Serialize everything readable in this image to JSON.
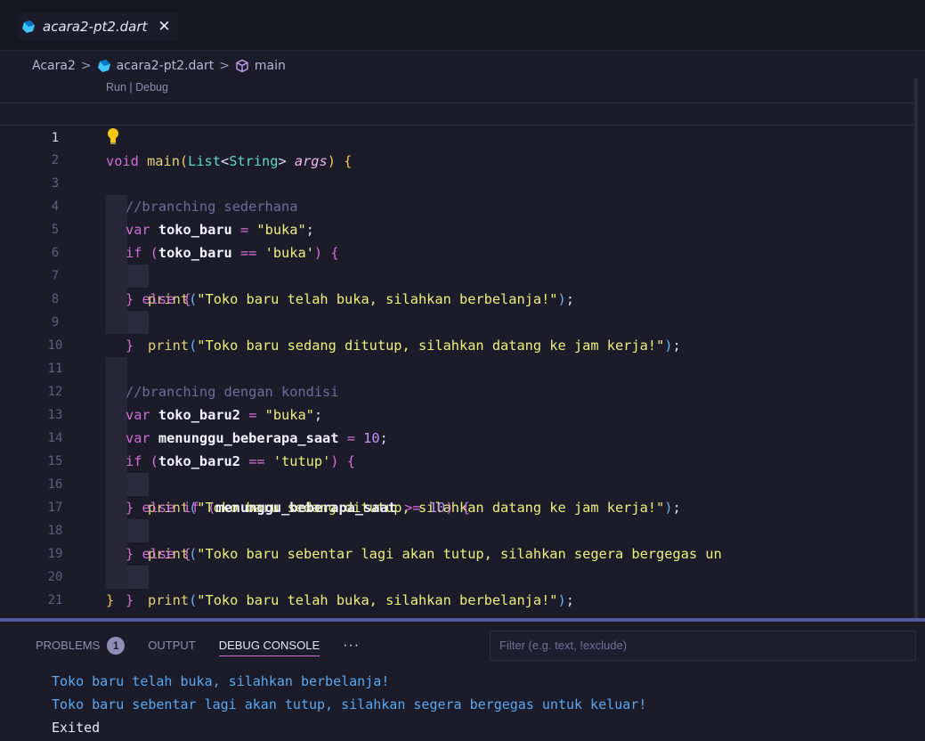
{
  "tab": {
    "title": "acara2-pt2.dart",
    "close_glyph": "✕"
  },
  "breadcrumb": {
    "folder": "Acara2",
    "file": "acara2-pt2.dart",
    "symbol": "main",
    "sep": ">"
  },
  "codelens": "Run | Debug",
  "lines": [
    {
      "n": "1"
    },
    {
      "n": "2"
    },
    {
      "n": "3"
    },
    {
      "n": "4"
    },
    {
      "n": "5"
    },
    {
      "n": "6"
    },
    {
      "n": "7"
    },
    {
      "n": "8"
    },
    {
      "n": "9"
    },
    {
      "n": "10"
    },
    {
      "n": "11"
    },
    {
      "n": "12"
    },
    {
      "n": "13"
    },
    {
      "n": "14"
    },
    {
      "n": "15"
    },
    {
      "n": "16"
    },
    {
      "n": "17"
    },
    {
      "n": "18"
    },
    {
      "n": "19"
    },
    {
      "n": "20"
    },
    {
      "n": "21"
    }
  ],
  "code": {
    "l1": {
      "void": "void",
      "main": "main",
      "list": "List",
      "string": "String",
      "args": "args"
    },
    "l2": {
      "comment": "//branching sederhana"
    },
    "l3": {
      "var": "var",
      "name": "toko_baru",
      "value": "\"buka\""
    },
    "l4": {
      "if": "if",
      "name": "toko_baru",
      "value": "'buka'"
    },
    "l5": {
      "print": "print",
      "value": "\"Toko baru telah buka, silahkan berbelanja!\""
    },
    "l6": {
      "else": "else"
    },
    "l7": {
      "print": "print",
      "value": "\"Toko baru sedang ditutup, silahkan datang ke jam kerja!\""
    },
    "l10": {
      "comment": "//branching dengan kondisi"
    },
    "l11": {
      "var": "var",
      "name": "toko_baru2",
      "value": "\"buka\""
    },
    "l12": {
      "var": "var",
      "name": "menunggu_beberapa_saat",
      "value": "10"
    },
    "l13": {
      "if": "if",
      "name": "toko_baru2",
      "value": "'tutup'"
    },
    "l14": {
      "print": "print",
      "value": "\"Toko baru sedang ditutup, silahkan datang ke jam kerja!\""
    },
    "l15": {
      "else": "else",
      "if": "if",
      "name": "menunggu_beberapa_saat",
      "value": "10"
    },
    "l16": {
      "print": "print",
      "value": "\"Toko baru sebentar lagi akan tutup, silahkan segera bergegas un"
    },
    "l17": {
      "else": "else"
    },
    "l18": {
      "print": "print",
      "value": "\"Toko baru telah buka, silahkan berbelanja!\""
    }
  },
  "panel": {
    "problems": "PROBLEMS",
    "problems_count": "1",
    "output": "OUTPUT",
    "debug_console": "DEBUG CONSOLE",
    "more": "···",
    "filter_placeholder": "Filter (e.g. text, !exclude)"
  },
  "console": [
    "Toko baru telah buka, silahkan berbelanja!",
    "Toko baru sebentar lagi akan tutup, silahkan segera bergegas untuk keluar!",
    "Exited"
  ],
  "colors": {
    "accent": "#d66fd6",
    "background": "#1b1b29",
    "console_text": "#5aa8f2"
  },
  "icons": {
    "file": "dart-icon",
    "symbol": "cube-icon",
    "hint": "lightbulb-icon"
  }
}
